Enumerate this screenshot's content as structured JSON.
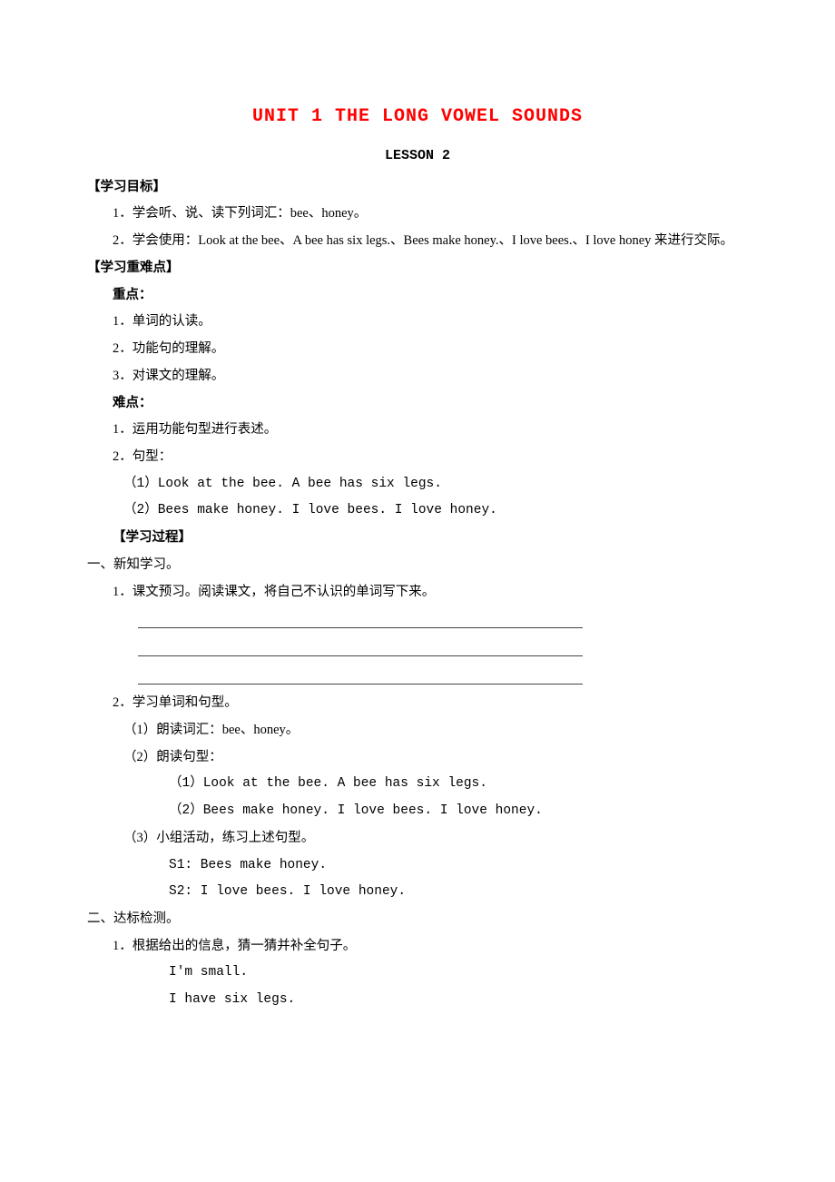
{
  "title": "UNIT 1 THE LONG VOWEL SOUNDS",
  "subtitle": "LESSON 2",
  "sections": {
    "objectives": {
      "heading": "【学习目标】",
      "items": [
        "1．学会听、说、读下列词汇：bee、honey。",
        "2．学会使用：Look at the bee、A bee has six legs.、Bees make honey.、I love bees.、I love honey 来进行交际。"
      ]
    },
    "keypoints": {
      "heading": "【学习重难点】",
      "zhongdian_label": "重点：",
      "zhongdian_items": [
        "1．单词的认读。",
        "2．功能句的理解。",
        "3．对课文的理解。"
      ],
      "nandian_label": "难点：",
      "nandian_items": [
        "1．运用功能句型进行表述。",
        "2．句型："
      ],
      "sentences": [
        "（1）Look at the bee. A bee has six legs.",
        "（2）Bees make honey. I love bees. I love honey."
      ]
    },
    "process": {
      "heading": "【学习过程】",
      "part1_heading": "一、新知学习。",
      "part1_item1": "1．课文预习。阅读课文，将自己不认识的单词写下来。",
      "part1_item2": "2．学习单词和句型。",
      "part1_sub": [
        "（1）朗读词汇：bee、honey。",
        "（2）朗读句型："
      ],
      "read_sentences": [
        "（1）Look at the bee. A bee has six legs.",
        "（2）Bees make honey. I love bees. I love honey."
      ],
      "group_label": "（3）小组活动，练习上述句型。",
      "dialogue": [
        "S1: Bees make honey.",
        "S2: I love bees. I love honey."
      ],
      "part2_heading": "二、达标检测。",
      "part2_item1": "1．根据给出的信息，猜一猜并补全句子。",
      "guess_lines": [
        "I'm small.",
        "I have six legs."
      ]
    }
  }
}
